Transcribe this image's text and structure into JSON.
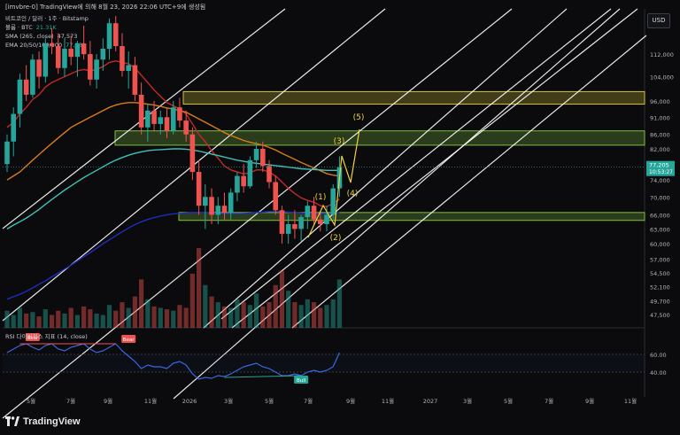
{
  "header": {
    "text": "[imvbre-0] TradingView에 의해 8월 23, 2026 22:06 UTC+9에 생성됨"
  },
  "currency_button": "USD",
  "legend": {
    "line1": "비트코인 / 달러 · 1주 · Bitstamp",
    "volume_label": "볼륨 · BTC",
    "volume_value": "21.31K",
    "sma_label": "SMA (265, close)",
    "sma_value": "47,573",
    "ema_label": "EMA 20/50/100/200",
    "ema_value": "77,231"
  },
  "rsi_label": "RSI 다이버전스 지표 (14, close)",
  "footer": {
    "brand": "TradingView"
  },
  "colors": {
    "background": "#0b0b0d",
    "up": "#26a69a",
    "down": "#ef5350",
    "ema_red": "#c62828",
    "ema_orange": "#d97b1a",
    "ema_teal": "#3fc1b7",
    "ema_blue": "#1e2dbb",
    "channel": "#ffffff",
    "zone_yellow": "#d4c23a",
    "zone_green": "#7fbf3f",
    "wave_label": "#f0d23c",
    "rsi_line": "#3a68e0"
  },
  "chart_data": {
    "type": "candlestick",
    "title": "비트코인 / 달러 · 1주 · Bitstamp",
    "y_scale": "log",
    "ylim": [
      45500,
      130000
    ],
    "price_ticks": [
      "112,000",
      "104,000",
      "96,000",
      "91,000",
      "86,000",
      "82,000",
      "78,000",
      "74,000",
      "70,000",
      "66,000",
      "63,000",
      "60,000",
      "57,000",
      "54,500",
      "52,100",
      "49,700",
      "47,500"
    ],
    "current_price": "77,205",
    "countdown": "10:53:27",
    "time_ticks": [
      "5월",
      "7월",
      "9월",
      "11월",
      "2026",
      "3월",
      "5월",
      "7월",
      "9월",
      "11월",
      "2027",
      "3월",
      "5월",
      "7월",
      "9월",
      "11월"
    ],
    "candles": [
      [
        78000,
        86000,
        76000,
        84000
      ],
      [
        84000,
        94000,
        80000,
        92000
      ],
      [
        92000,
        105000,
        88000,
        103000
      ],
      [
        103000,
        108000,
        96000,
        98000
      ],
      [
        98000,
        112000,
        97000,
        110000
      ],
      [
        110000,
        113000,
        100000,
        104000
      ],
      [
        104000,
        118000,
        102000,
        116000
      ],
      [
        116000,
        122000,
        112000,
        115000
      ],
      [
        115000,
        120000,
        105000,
        107000
      ],
      [
        107000,
        118000,
        104000,
        114000
      ],
      [
        114000,
        119000,
        108000,
        111000
      ],
      [
        111000,
        117000,
        104000,
        116000
      ],
      [
        116000,
        123000,
        110000,
        112000
      ],
      [
        112000,
        117000,
        101000,
        103000
      ],
      [
        103000,
        112000,
        100000,
        110000
      ],
      [
        110000,
        118000,
        106000,
        114000
      ],
      [
        114000,
        126000,
        110000,
        124000
      ],
      [
        124000,
        127000,
        113000,
        115000
      ],
      [
        115000,
        120000,
        104000,
        106000
      ],
      [
        106000,
        113000,
        100000,
        108000
      ],
      [
        108000,
        111000,
        96000,
        98000
      ],
      [
        98000,
        102000,
        86000,
        88000
      ],
      [
        88000,
        95000,
        84000,
        93000
      ],
      [
        93000,
        96000,
        87000,
        89000
      ],
      [
        89000,
        93000,
        86000,
        91000
      ],
      [
        91000,
        94000,
        85000,
        87000
      ],
      [
        87000,
        96000,
        86000,
        94000
      ],
      [
        94000,
        97000,
        88000,
        90000
      ],
      [
        90000,
        93000,
        84000,
        86000
      ],
      [
        86000,
        88000,
        74000,
        76000
      ],
      [
        76000,
        79000,
        66000,
        68000
      ],
      [
        68000,
        73000,
        63000,
        70000
      ],
      [
        70000,
        72000,
        64000,
        66000
      ],
      [
        66000,
        70000,
        64000,
        68000
      ],
      [
        68000,
        71000,
        65000,
        66500
      ],
      [
        66500,
        72000,
        65000,
        71000
      ],
      [
        71000,
        76000,
        69000,
        75000
      ],
      [
        75000,
        78000,
        71000,
        72500
      ],
      [
        72500,
        80000,
        72000,
        79000
      ],
      [
        79000,
        84000,
        77000,
        82000
      ],
      [
        82000,
        84000,
        76000,
        77500
      ],
      [
        77500,
        79000,
        72000,
        73500
      ],
      [
        73500,
        75000,
        66000,
        67000
      ],
      [
        67000,
        68000,
        60000,
        62000
      ],
      [
        62000,
        66000,
        60000,
        64000
      ],
      [
        64000,
        67000,
        61000,
        63000
      ],
      [
        63000,
        66000,
        60500,
        65500
      ],
      [
        65500,
        69000,
        63000,
        68000
      ],
      [
        68000,
        70000,
        64000,
        65000
      ],
      [
        65000,
        66500,
        62500,
        64000
      ],
      [
        64000,
        68000,
        62500,
        66000
      ],
      [
        66000,
        73000,
        65000,
        72000
      ],
      [
        72000,
        80000,
        70000,
        77205
      ]
    ],
    "series": [
      {
        "name": "EMA 20",
        "values": [
          88000,
          89500,
          92000,
          94000,
          96500,
          98000,
          100500,
          102000,
          103000,
          104000,
          105000,
          106000,
          106500,
          106000,
          106500,
          107500,
          109000,
          109500,
          109000,
          108500,
          107000,
          104500,
          102000,
          99500,
          97500,
          95500,
          94500,
          93500,
          92000,
          89000,
          86000,
          84000,
          81500,
          79500,
          77500,
          76500,
          76000,
          75500,
          75800,
          76500,
          76500,
          76000,
          75000,
          73500,
          72000,
          70800,
          69800,
          69200,
          68800,
          68000,
          67800,
          68500,
          69500
        ]
      },
      {
        "name": "EMA 50",
        "values": [
          74000,
          75000,
          76000,
          77500,
          79000,
          80500,
          82000,
          83500,
          85000,
          86500,
          88000,
          89000,
          90000,
          91000,
          92000,
          93000,
          94000,
          94700,
          95200,
          95500,
          95500,
          95300,
          95000,
          94700,
          94300,
          93800,
          93500,
          93000,
          92500,
          91500,
          90500,
          89500,
          88500,
          87500,
          86500,
          85700,
          85000,
          84300,
          83800,
          83400,
          83000,
          82400,
          81700,
          80800,
          80000,
          79200,
          78400,
          77700,
          77000,
          76300,
          75600,
          75200,
          75000
        ]
      },
      {
        "name": "EMA 100",
        "values": [
          63000,
          63800,
          64500,
          65300,
          66200,
          67200,
          68300,
          69400,
          70500,
          71600,
          72600,
          73600,
          74600,
          75500,
          76400,
          77300,
          78200,
          79000,
          79700,
          80300,
          80800,
          81200,
          81500,
          81700,
          81800,
          81900,
          82000,
          82000,
          81900,
          81700,
          81400,
          81000,
          80600,
          80200,
          79800,
          79400,
          79000,
          78700,
          78400,
          78200,
          78000,
          77800,
          77600,
          77400,
          77200,
          77000,
          76800,
          76700,
          76600,
          76500,
          76400,
          76400,
          76400
        ]
      },
      {
        "name": "EMA 200",
        "values": [
          50000,
          50400,
          50800,
          51300,
          51900,
          52500,
          53100,
          53800,
          54500,
          55200,
          55900,
          56700,
          57500,
          58300,
          59100,
          60000,
          60800,
          61600,
          62400,
          63200,
          63900,
          64500,
          65000,
          65400,
          65700,
          66000,
          66200,
          66300,
          66400,
          66500,
          66500,
          66500,
          66400,
          66300,
          66200,
          66200,
          66200,
          66300,
          66400,
          66500,
          66600,
          66700,
          66700,
          66700,
          66600,
          66500,
          66400,
          66300,
          66300,
          66200,
          66200,
          66300,
          66500
        ]
      }
    ],
    "volume": [
      12,
      9,
      14,
      10,
      11,
      8,
      13,
      9,
      12,
      10,
      14,
      9,
      15,
      13,
      10,
      9,
      16,
      12,
      18,
      14,
      22,
      34,
      20,
      15,
      14,
      13,
      12,
      16,
      14,
      38,
      56,
      30,
      22,
      18,
      15,
      14,
      20,
      18,
      16,
      24,
      15,
      18,
      30,
      40,
      26,
      18,
      16,
      20,
      18,
      14,
      16,
      20,
      34
    ],
    "zones": [
      {
        "name": "yellow",
        "from": 95000,
        "to": 99000
      },
      {
        "name": "green-upper",
        "from": 83000,
        "to": 87000
      },
      {
        "name": "green-lower",
        "from": 64800,
        "to": 66500
      }
    ],
    "wave_labels": [
      "(1)",
      "(2)",
      "(3)",
      "(4)",
      "(5)"
    ],
    "rsi": {
      "ylim": [
        20,
        80
      ],
      "levels": [
        "60.00",
        "40.00"
      ],
      "values": [
        62,
        66,
        70,
        72,
        68,
        65,
        70,
        72,
        66,
        64,
        68,
        70,
        72,
        66,
        62,
        64,
        68,
        72,
        64,
        58,
        52,
        44,
        48,
        46,
        46,
        44,
        50,
        52,
        48,
        38,
        32,
        34,
        33,
        36,
        35,
        38,
        42,
        46,
        48,
        50,
        46,
        44,
        40,
        36,
        36,
        38,
        36,
        40,
        42,
        40,
        42,
        46,
        62
      ],
      "bear_labels": [
        "Bear",
        "Bear"
      ],
      "bull_labels": [
        "Bull"
      ]
    }
  }
}
